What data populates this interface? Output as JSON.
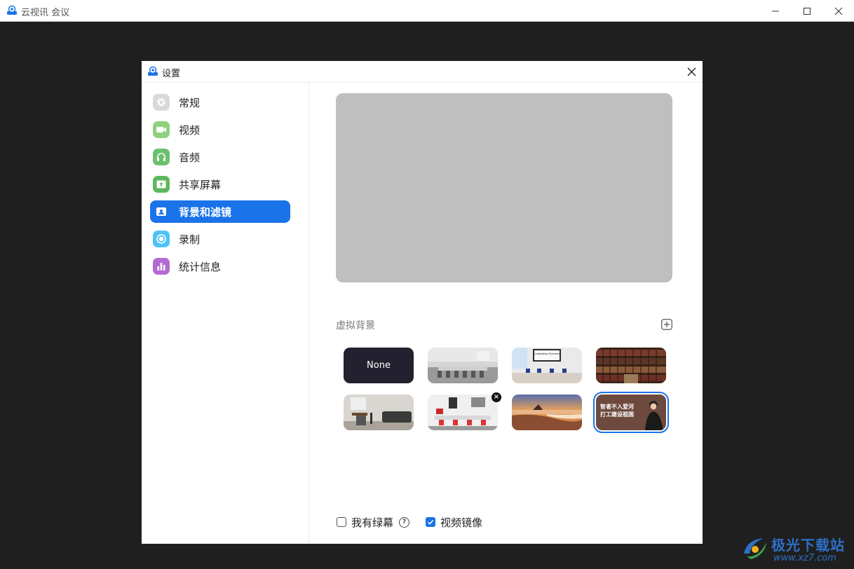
{
  "window": {
    "title": "云视讯 会议"
  },
  "dialog": {
    "title": "设置"
  },
  "sidebar": {
    "items": [
      {
        "label": "常规",
        "icon": "gear-icon",
        "color": "#d4d4d4"
      },
      {
        "label": "视频",
        "icon": "camera-icon",
        "color": "#7cc86e"
      },
      {
        "label": "音频",
        "icon": "headphones-icon",
        "color": "#5cb85c"
      },
      {
        "label": "共享屏幕",
        "icon": "share-screen-icon",
        "color": "#5cb85c"
      },
      {
        "label": "背景和滤镜",
        "icon": "background-icon",
        "color": "#1a73e8",
        "active": true
      },
      {
        "label": "录制",
        "icon": "record-icon",
        "color": "#4fc3f7"
      },
      {
        "label": "统计信息",
        "icon": "stats-icon",
        "color": "#b36bd1"
      }
    ]
  },
  "content": {
    "section_title": "虚拟背景",
    "backgrounds": [
      {
        "name": "none",
        "label": "None"
      },
      {
        "name": "meeting-room-gray"
      },
      {
        "name": "conference-room-screen",
        "screen_text": "Contactless Economy"
      },
      {
        "name": "bookshelf"
      },
      {
        "name": "lounge-sofa"
      },
      {
        "name": "white-office",
        "removable": true
      },
      {
        "name": "sunset-beach"
      },
      {
        "name": "poster",
        "line1": "智者不入爱河",
        "line2": "打工建设祖国",
        "selected": true
      }
    ],
    "options": {
      "green_screen": {
        "label": "我有绿幕",
        "checked": false
      },
      "mirror": {
        "label": "视频镜像",
        "checked": true
      }
    }
  },
  "watermark": {
    "text": "极光下载站",
    "url": "www.xz7.com"
  },
  "colors": {
    "accent": "#1a73e8",
    "backdrop": "#1f1f1f",
    "preview": "#bfbfbf"
  }
}
